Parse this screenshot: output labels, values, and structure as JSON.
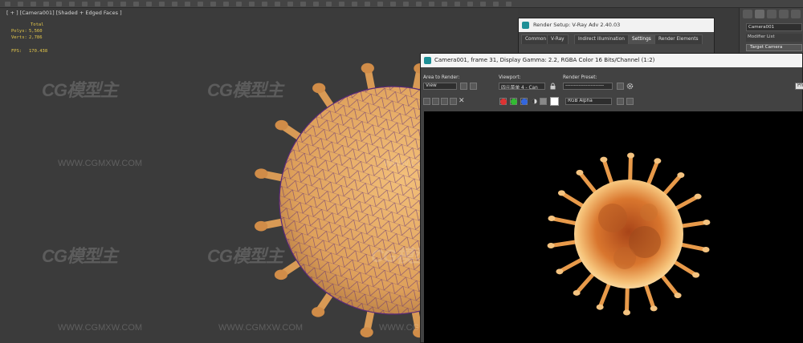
{
  "toolbar": {
    "button_count": 40
  },
  "viewport": {
    "label": "[ + ] [Camera001] [Shaded + Edged Faces ]",
    "stats": {
      "total_label": "Total",
      "polys_label": "Polys:",
      "polys_value": "5,560",
      "verts_label": "Verts:",
      "verts_value": "2,786",
      "fps_label": "FPS:",
      "fps_value": "170.438"
    }
  },
  "watermark": {
    "logo": "CG模型主",
    "url": "WWW.CGMXW.COM"
  },
  "command_panel": {
    "object_name": "Camera001",
    "modifier_list": "Modifier List",
    "stack_item": "Target Camera"
  },
  "render_setup": {
    "title": "Render Setup: V-Ray Adv 2.40.03",
    "tabs": [
      "Common",
      "V-Ray",
      "Indirect illumination",
      "Settings",
      "Render Elements"
    ],
    "active_tab": "Settings"
  },
  "frame_buffer": {
    "title": "Camera001, frame 31, Display Gamma: 2.2, RGBA Color 16 Bits/Channel (1:2)",
    "area_to_render_label": "Area to Render:",
    "area_to_render_value": "View",
    "viewport_label": "Viewport:",
    "viewport_value": "四元菜单 4 - Can",
    "render_preset_label": "Render Preset:",
    "render_preset_value": "-----------------------",
    "channel_value": "RGB Alpha",
    "render_button": "Prod"
  },
  "colors": {
    "viewport_bg": "#3b3b3b",
    "stat_text": "#e5c84a",
    "mesh_fill": "#e0a55e",
    "mesh_wire": "#5a2a78",
    "render_bg": "#000000",
    "render_virus": "#f0a040"
  }
}
